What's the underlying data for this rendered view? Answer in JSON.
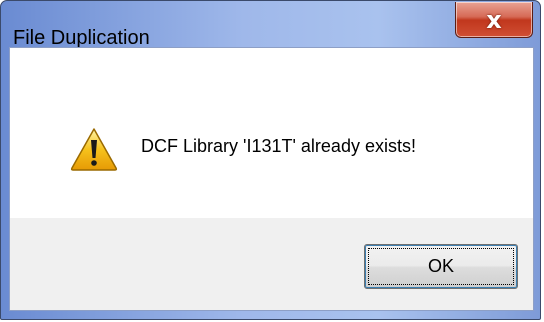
{
  "dialog": {
    "title": "File Duplication",
    "close_label": "x",
    "message": "DCF Library 'I131T' already exists!",
    "ok_label": "OK",
    "icon": "warning-icon",
    "colors": {
      "close_button": "#c1371d",
      "frame": "#9fb8ea",
      "warning_fill": "#f6c21c"
    }
  }
}
